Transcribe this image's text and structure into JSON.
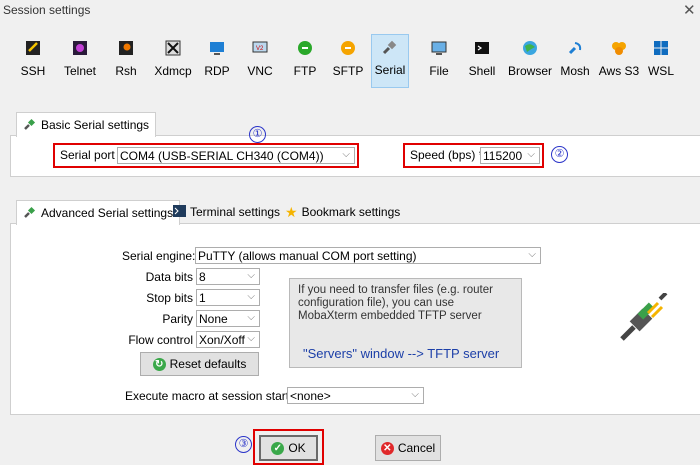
{
  "window": {
    "title": "Session settings",
    "close_glyph": "✕"
  },
  "toolbar": {
    "selected": "Serial",
    "items": [
      {
        "label": "SSH",
        "icon": "ssh-icon"
      },
      {
        "label": "Telnet",
        "icon": "telnet-icon"
      },
      {
        "label": "Rsh",
        "icon": "rsh-icon"
      },
      {
        "label": "Xdmcp",
        "icon": "xdmcp-icon"
      },
      {
        "label": "RDP",
        "icon": "rdp-icon"
      },
      {
        "label": "VNC",
        "icon": "vnc-icon"
      },
      {
        "label": "FTP",
        "icon": "ftp-icon"
      },
      {
        "label": "SFTP",
        "icon": "sftp-icon"
      },
      {
        "label": "Serial",
        "icon": "serial-icon"
      },
      {
        "label": "File",
        "icon": "file-icon"
      },
      {
        "label": "Shell",
        "icon": "shell-icon"
      },
      {
        "label": "Browser",
        "icon": "browser-icon"
      },
      {
        "label": "Mosh",
        "icon": "mosh-icon"
      },
      {
        "label": "Aws S3",
        "icon": "aws-s3-icon"
      },
      {
        "label": "WSL",
        "icon": "wsl-icon"
      }
    ]
  },
  "basic": {
    "tab_label": "Basic Serial settings",
    "serial_port_label": "Serial port *",
    "serial_port_value": "COM4  (USB-SERIAL CH340 (COM4))",
    "speed_label": "Speed (bps) *",
    "speed_value": "115200"
  },
  "advanced": {
    "tabs": [
      {
        "label": "Advanced Serial settings",
        "icon": "serial-icon"
      },
      {
        "label": "Terminal settings",
        "icon": "terminal-icon"
      },
      {
        "label": "Bookmark settings",
        "icon": "star-icon"
      }
    ],
    "serial_engine_label": "Serial engine:",
    "serial_engine_value": "PuTTY    (allows manual COM port setting)",
    "data_bits_label": "Data bits",
    "data_bits_value": "8",
    "stop_bits_label": "Stop bits",
    "stop_bits_value": "1",
    "parity_label": "Parity",
    "parity_value": "None",
    "flow_control_label": "Flow control",
    "flow_control_value": "Xon/Xoff",
    "reset_label": "Reset defaults",
    "info_text": "If you need to transfer files (e.g. router configuration file), you can use MobaXterm embedded TFTP server",
    "info_link": "\"Servers\" window  -->  TFTP server",
    "macro_label": "Execute macro at session start:",
    "macro_value": "<none>"
  },
  "footer": {
    "ok_label": "OK",
    "cancel_label": "Cancel"
  },
  "annotations": [
    "①",
    "②",
    "③"
  ],
  "colors": {
    "highlight_red": "#e00000",
    "annotation_blue": "#2b35c9",
    "selected_tab_bg": "#cde6f7"
  }
}
